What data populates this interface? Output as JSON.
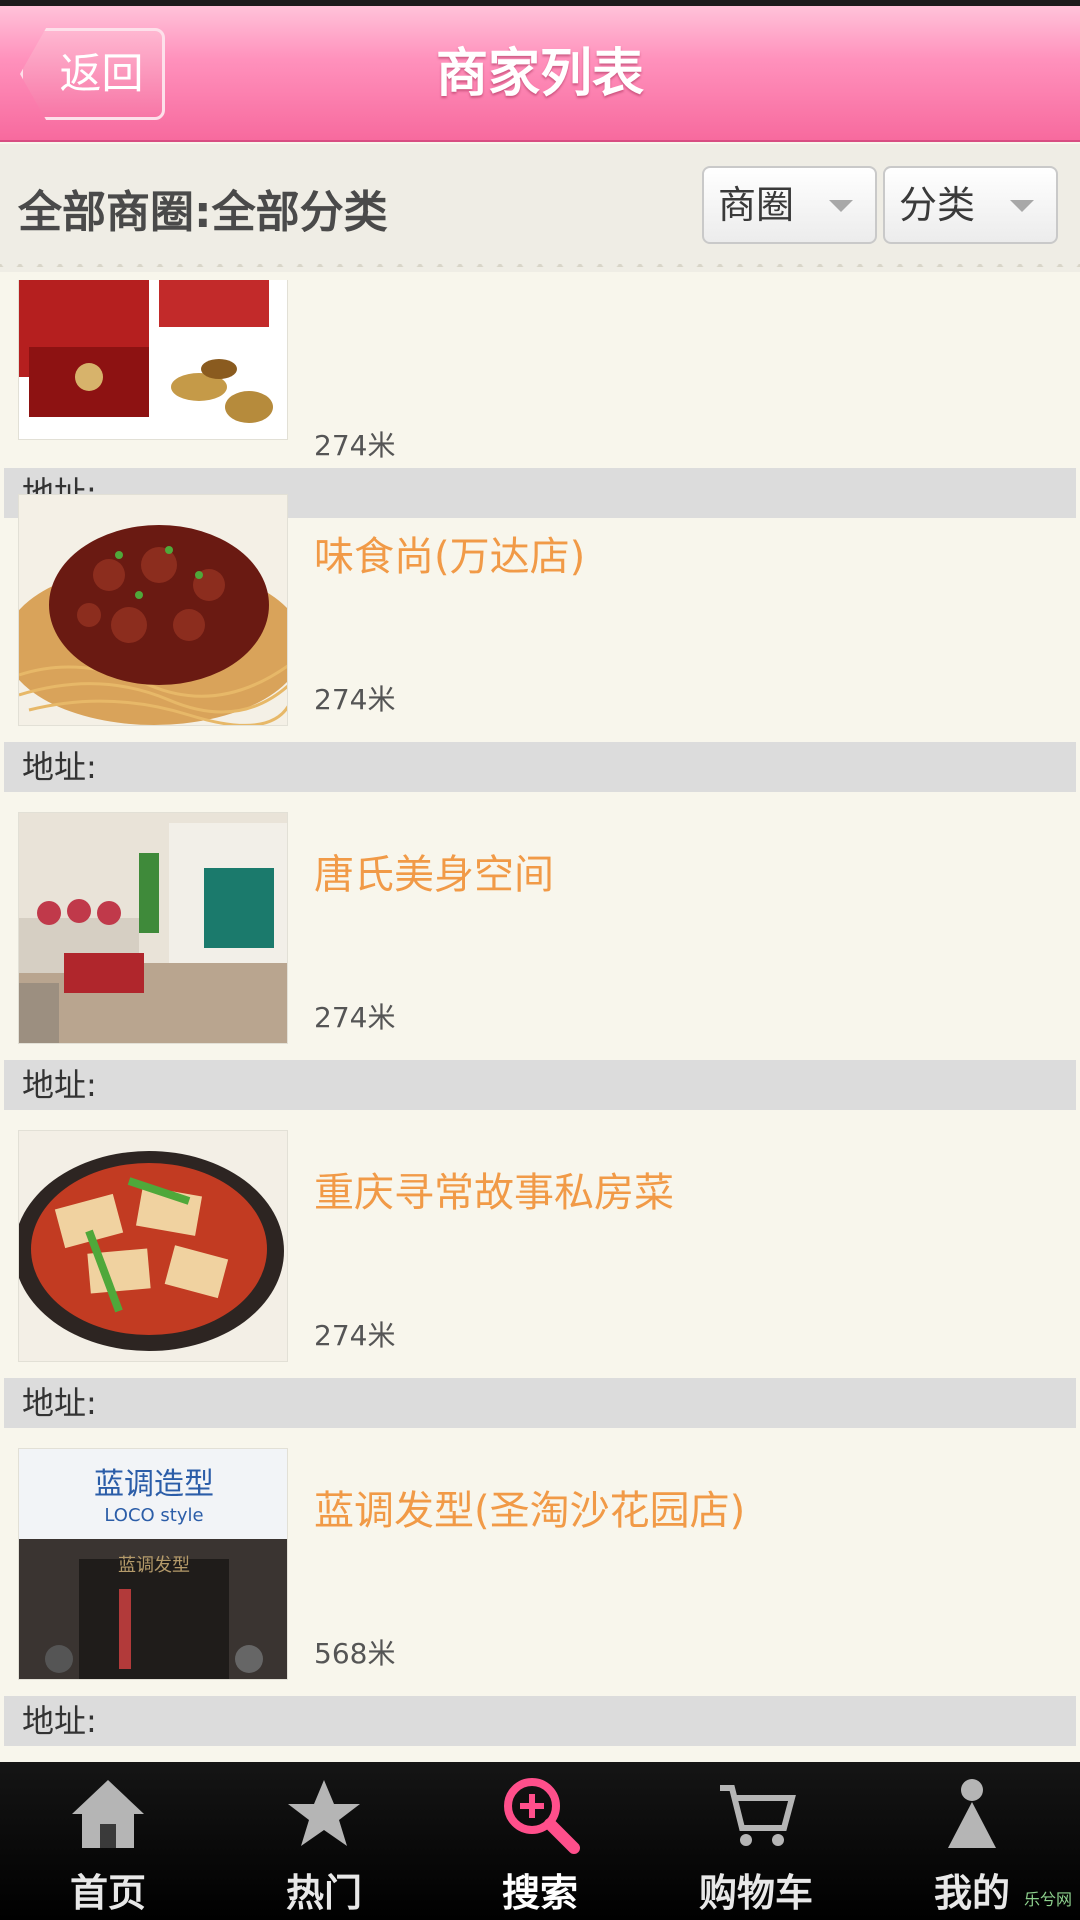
{
  "header": {
    "back_label": "返回",
    "title": "商家列表"
  },
  "filter": {
    "label": "全部商圈:全部分类",
    "area_dropdown": "商圈",
    "category_dropdown": "分类"
  },
  "list": [
    {
      "name": "",
      "distance": "274米",
      "address_label": "地址:"
    },
    {
      "name": "味食尚(万达店)",
      "distance": "274米",
      "address_label": "地址:"
    },
    {
      "name": "唐氏美身空间",
      "distance": "274米",
      "address_label": "地址:"
    },
    {
      "name": "重庆寻常故事私房菜",
      "distance": "274米",
      "address_label": "地址:"
    },
    {
      "name": "蓝调发型(圣淘沙花园店)",
      "distance": "568米",
      "address_label": "地址:"
    }
  ],
  "store_sign": {
    "line1": "蓝调造型",
    "line2": "LOCO style",
    "line3": "蓝调发型"
  },
  "tabs": [
    {
      "label": "首页",
      "icon": "home-icon"
    },
    {
      "label": "热门",
      "icon": "star-icon"
    },
    {
      "label": "搜索",
      "icon": "search-icon"
    },
    {
      "label": "购物车",
      "icon": "cart-icon"
    },
    {
      "label": "我的",
      "icon": "user-icon"
    }
  ],
  "watermark": "乐兮网",
  "colors": {
    "header_pink": "#f76a9e",
    "merchant_name": "#f19a47",
    "active_tab_icon": "#ff4f8b"
  }
}
